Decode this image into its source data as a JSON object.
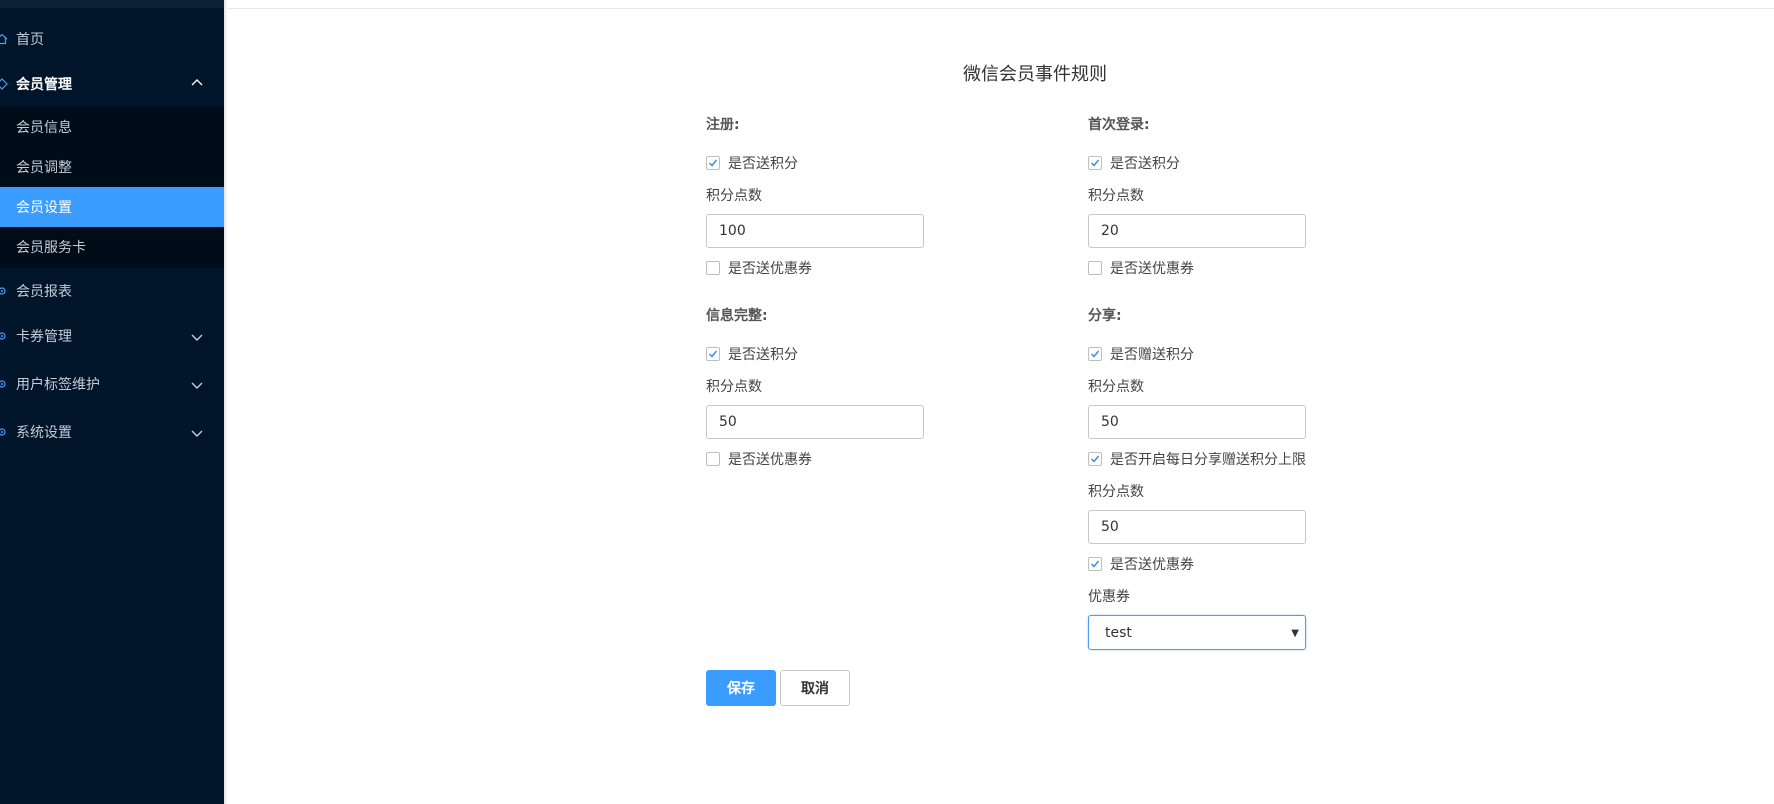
{
  "sidebar": {
    "items": [
      {
        "label": "首页",
        "icon": "home-icon"
      },
      {
        "label": "会员管理",
        "icon": "diamond-icon",
        "expanded": true
      },
      {
        "label": "会员报表",
        "icon": "gear-icon"
      },
      {
        "label": "卡券管理",
        "icon": "gear-icon"
      },
      {
        "label": "用户标签维护",
        "icon": "gear-icon"
      },
      {
        "label": "系统设置",
        "icon": "gear-icon"
      }
    ],
    "submenu": [
      {
        "label": "会员信息"
      },
      {
        "label": "会员调整"
      },
      {
        "label": "会员设置",
        "active": true
      },
      {
        "label": "会员服务卡"
      }
    ]
  },
  "form": {
    "title": "微信会员事件规则",
    "register": {
      "title": "注册:",
      "send_points_label": "是否送积分",
      "send_points_checked": true,
      "points_label": "积分点数",
      "points_value": "100",
      "send_coupon_label": "是否送优惠券",
      "send_coupon_checked": false
    },
    "first_login": {
      "title": "首次登录:",
      "send_points_label": "是否送积分",
      "send_points_checked": true,
      "points_label": "积分点数",
      "points_value": "20",
      "send_coupon_label": "是否送优惠券",
      "send_coupon_checked": false
    },
    "info_complete": {
      "title": "信息完整:",
      "send_points_label": "是否送积分",
      "send_points_checked": true,
      "points_label": "积分点数",
      "points_value": "50",
      "send_coupon_label": "是否送优惠券",
      "send_coupon_checked": false
    },
    "share": {
      "title": "分享:",
      "gift_points_label": "是否赠送积分",
      "gift_points_checked": true,
      "points_label": "积分点数",
      "points_value": "50",
      "daily_limit_label": "是否开启每日分享赠送积分上限",
      "daily_limit_checked": true,
      "limit_points_label": "积分点数",
      "limit_points_value": "50",
      "send_coupon_label": "是否送优惠券",
      "send_coupon_checked": true,
      "coupon_label": "优惠券",
      "coupon_selected": "test"
    },
    "save_label": "保存",
    "cancel_label": "取消"
  },
  "colors": {
    "sidebar_bg": "#001529",
    "submenu_bg": "#000c17",
    "active_item": "#3a9cff",
    "primary_button": "#3a9cff"
  }
}
